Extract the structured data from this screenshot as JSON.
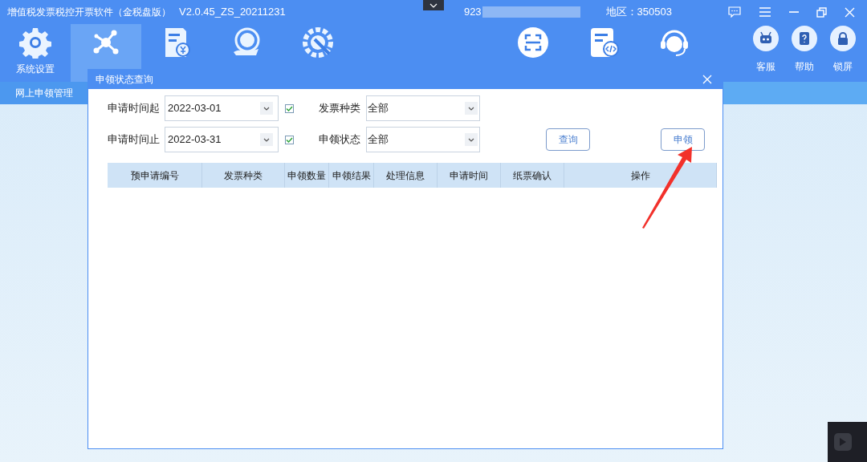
{
  "app": {
    "title": "增值税发票税控开票软件（金税盘版）",
    "version": "V2.0.45_ZS_20211231",
    "account": "923",
    "region": "地区：350503"
  },
  "ribbon": [
    {
      "kind": "gear",
      "label": "系统设置",
      "selected": false
    },
    {
      "kind": "network",
      "selected": true
    },
    {
      "kind": "invoice"
    },
    {
      "kind": "tax"
    },
    {
      "kind": "wrench"
    }
  ],
  "ribbon_right": [
    {
      "kind": "scan"
    },
    {
      "kind": "code"
    },
    {
      "kind": "headset"
    }
  ],
  "quick": [
    {
      "kind": "robot",
      "label": "客服"
    },
    {
      "kind": "book",
      "label": "帮助"
    },
    {
      "kind": "lock",
      "label": "锁屏"
    }
  ],
  "subnav": [
    {
      "label": "网上申领管理",
      "selected": true
    }
  ],
  "dialog": {
    "title": "申领状态查询",
    "fields": [
      {
        "label": "申请时间起",
        "value": "2022-03-01",
        "checked": true
      },
      {
        "label": "申请时间止",
        "value": "2022-03-31",
        "checked": true
      }
    ],
    "selects": [
      {
        "label": "发票种类",
        "value": "全部"
      },
      {
        "label": "申领状态",
        "value": "全部"
      }
    ],
    "buttons": [
      "查询",
      "申领"
    ],
    "table": {
      "columns": [
        "预申请编号",
        "发票种类",
        "申领数量",
        "申领结果",
        "处理信息",
        "申请时间",
        "纸票确认",
        "操作"
      ]
    }
  }
}
